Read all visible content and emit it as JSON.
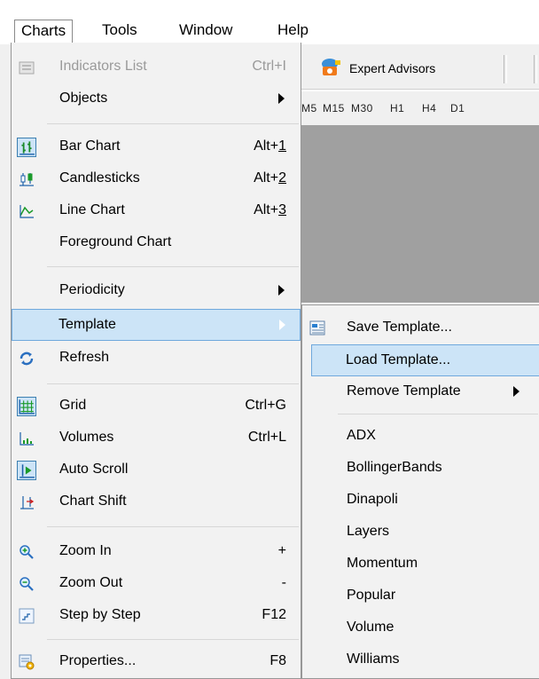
{
  "menubar": {
    "items": [
      "Charts",
      "Tools",
      "Window",
      "Help"
    ]
  },
  "toolbar": {
    "expert_advisors": "Expert Advisors",
    "periods": [
      "M5",
      "M15",
      "M30",
      "H1",
      "H4",
      "D1"
    ]
  },
  "charts_menu": {
    "indicators_list": {
      "label": "Indicators List",
      "shortcut": "Ctrl+I"
    },
    "objects": {
      "label": "Objects"
    },
    "bar_chart": {
      "label": "Bar Chart",
      "shortcut_prefix": "Alt+",
      "shortcut_key": "1"
    },
    "candlesticks": {
      "label": "Candlesticks",
      "shortcut_prefix": "Alt+",
      "shortcut_key": "2"
    },
    "line_chart": {
      "label": "Line Chart",
      "shortcut_prefix": "Alt+",
      "shortcut_key": "3"
    },
    "foreground_chart": {
      "label": "Foreground Chart"
    },
    "periodicity": {
      "label": "Periodicity"
    },
    "template": {
      "label": "Template"
    },
    "refresh": {
      "label": "Refresh"
    },
    "grid": {
      "label": "Grid",
      "shortcut": "Ctrl+G"
    },
    "volumes": {
      "label": "Volumes",
      "shortcut": "Ctrl+L"
    },
    "auto_scroll": {
      "label": "Auto Scroll"
    },
    "chart_shift": {
      "label": "Chart Shift"
    },
    "zoom_in": {
      "label": "Zoom In",
      "shortcut": "+"
    },
    "zoom_out": {
      "label": "Zoom Out",
      "shortcut": "-"
    },
    "step_by_step": {
      "label": "Step by Step",
      "shortcut": "F12"
    },
    "properties": {
      "label": "Properties...",
      "shortcut": "F8"
    }
  },
  "template_submenu": {
    "save": "Save Template...",
    "load": "Load Template...",
    "remove": "Remove Template",
    "templates": [
      "ADX",
      "BollingerBands",
      "Dinapoli",
      "Layers",
      "Momentum",
      "Popular",
      "Volume",
      "Williams"
    ]
  }
}
